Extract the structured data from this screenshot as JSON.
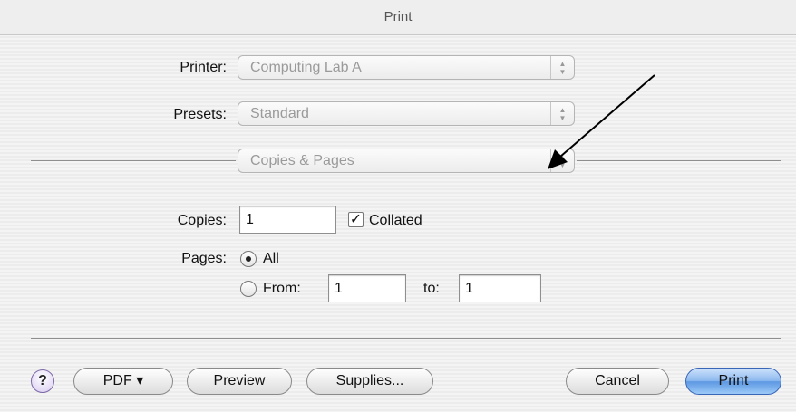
{
  "window": {
    "title": "Print"
  },
  "printer": {
    "label": "Printer:",
    "value": "Computing Lab A"
  },
  "presets": {
    "label": "Presets:",
    "value": "Standard"
  },
  "panel": {
    "value": "Copies & Pages"
  },
  "copies": {
    "label": "Copies:",
    "value": "1",
    "collated_label": "Collated",
    "collated_checked": true
  },
  "pages": {
    "label": "Pages:",
    "all_label": "All",
    "from_label": "From:",
    "from_value": "1",
    "to_label": "to:",
    "to_value": "1",
    "selected": "All"
  },
  "buttons": {
    "help": "?",
    "pdf": "PDF ▾",
    "preview": "Preview",
    "supplies": "Supplies...",
    "cancel": "Cancel",
    "print": "Print"
  }
}
